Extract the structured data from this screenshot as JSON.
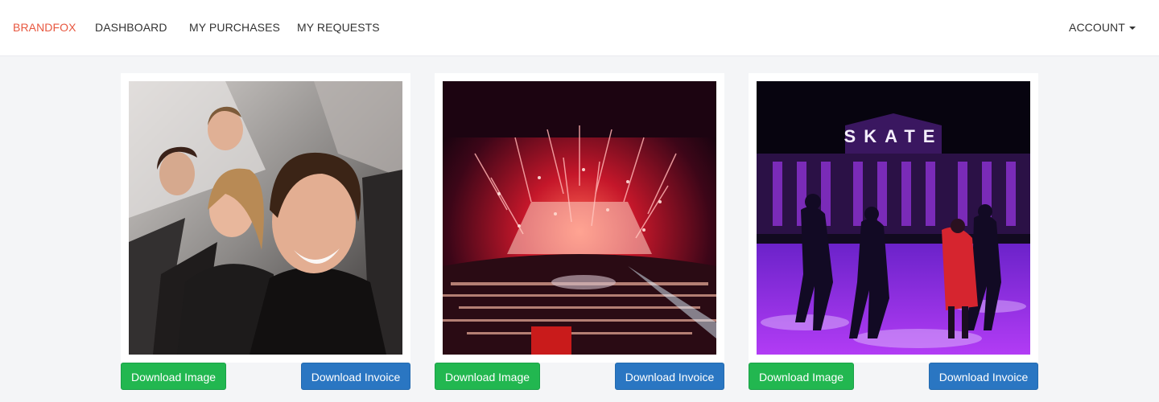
{
  "nav": {
    "brand": "BRANDFOX",
    "dashboard": "DASHBOARD",
    "purchases": "MY PURCHASES",
    "requests": "MY REQUESTS",
    "account": "ACCOUNT"
  },
  "colors": {
    "brand": "#e8573f",
    "download_image_button": "#22b750",
    "download_invoice_button": "#2a76c2"
  },
  "cards": [
    {
      "image_subject": "selfie-on-escalator",
      "download_image_label": "Download Image",
      "download_invoice_label": "Download Invoice"
    },
    {
      "image_subject": "concert-confetti-crowd",
      "download_image_label": "Download Image",
      "download_invoice_label": "Download Invoice"
    },
    {
      "image_subject": "ice-skating-rink-at-night",
      "download_image_label": "Download Image",
      "download_invoice_label": "Download Invoice",
      "sign_text": "SKATE"
    }
  ]
}
